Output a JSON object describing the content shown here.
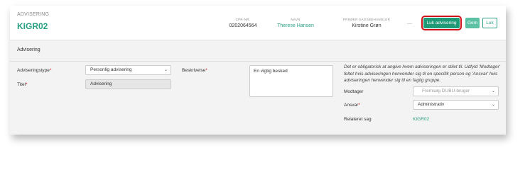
{
  "header": {
    "case_type": "ADVISERING",
    "case_id": "KIGR02",
    "cpr_label": "CPR-NR.",
    "cpr_value": "0202064564",
    "navn_label": "NAVN",
    "navn_value": "Therese Hansen",
    "handler_label": "PRIMÆR SAGSBEHANDLER",
    "handler_value": "Kirstine Grøn",
    "dash": "—",
    "buttons": {
      "close_advisering": "Luk advisering",
      "save": "Gem",
      "close": "Luk"
    }
  },
  "section": {
    "title": "Advisering"
  },
  "form": {
    "type_label": "Adviseringstype",
    "type_value": "Personlig advisering",
    "title_label": "Titel",
    "title_value": "Advisering",
    "description_label": "Beskrivelse",
    "description_value": "En vigtig besked",
    "info_text": "Det er obligatorisk at angive hvem adviseringen er stilet til. Udfyld 'Modtager' feltet hvis adviseringen henvender sig til en specifik person og 'Ansvar' hvis adviseringen henvender sig til en faglig gruppe.",
    "recipient_label": "Modtager",
    "recipient_placeholder": "Fremsøg DUBU-bruger",
    "responsibility_label": "Ansvar",
    "responsibility_value": "Administrativ",
    "related_label": "Relateret sag",
    "related_value": "KIGR02",
    "required_mark": "*"
  },
  "colors": {
    "accent": "#2aa083",
    "primary_button": "#1f9a76",
    "highlight": "#d0141a"
  }
}
